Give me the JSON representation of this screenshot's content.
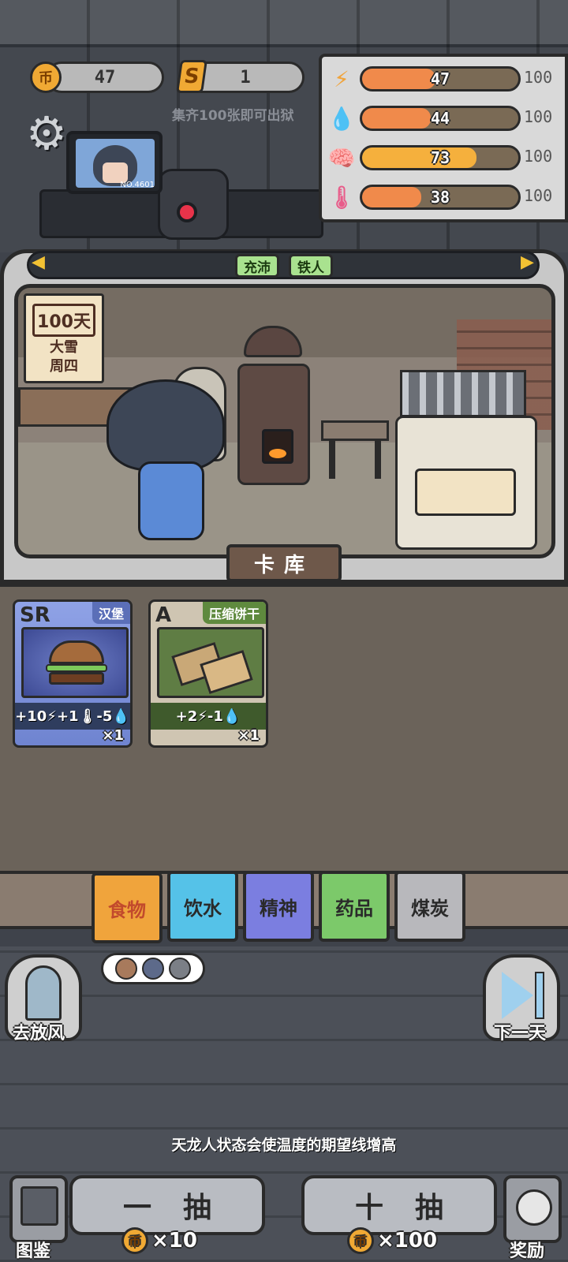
{
  "currency": {
    "coins": "47",
    "coin_symbol": "币",
    "s_symbol": "S",
    "s_count": "1"
  },
  "escape_hint": "集齐100张即可出狱",
  "prisoner_no": "NO.4601",
  "stats": [
    {
      "name": "energy",
      "icon": "lightning-icon",
      "glyph": "⚡",
      "value": "47",
      "max": "100",
      "fill": 0.47,
      "color": "#f08a4b"
    },
    {
      "name": "water",
      "icon": "water-drop-icon",
      "glyph": "💧",
      "value": "44",
      "max": "100",
      "fill": 0.44,
      "color": "#f08a4b"
    },
    {
      "name": "mind",
      "icon": "brain-icon",
      "glyph": "🧠",
      "value": "73",
      "max": "100",
      "fill": 0.73,
      "color": "#f5b03d"
    },
    {
      "name": "temperature",
      "icon": "thermometer-icon",
      "glyph": "🌡",
      "value": "38",
      "max": "100",
      "fill": 0.38,
      "color": "#f08a4b"
    }
  ],
  "status_tags": [
    "充沛",
    "铁人"
  ],
  "calendar": {
    "days": "100天",
    "weather": "大雪",
    "weekday": "周四"
  },
  "card_library_label": "卡库",
  "cards": [
    {
      "rank": "SR",
      "name": "汉堡",
      "effect": "+10⚡+1🌡-5💧",
      "count": "×1",
      "bg": "#8fa2e6",
      "name_bg": "#5b6fb8",
      "rank_color": "#ffffff"
    },
    {
      "rank": "A",
      "name": "压缩饼干",
      "effect": "+2⚡-1💧",
      "count": "×1",
      "bg": "#cfc5b2",
      "name_bg": "#5f8a3e",
      "rank_color": "#2a2a2a"
    }
  ],
  "categories": [
    {
      "label": "食物",
      "color": "#f0a43c",
      "active": true
    },
    {
      "label": "饮水",
      "color": "#55c2e8",
      "active": false
    },
    {
      "label": "精神",
      "color": "#7b7ee0",
      "active": false
    },
    {
      "label": "药品",
      "color": "#7cc96a",
      "active": false
    },
    {
      "label": "煤炭",
      "color": "#b8b8bc",
      "active": false
    }
  ],
  "buttons": {
    "yard": "去放风",
    "next_day": "下一天",
    "codex": "图鉴",
    "reward": "奖励",
    "draw_one": "一抽",
    "draw_ten": "十抽",
    "cost_one": "×10",
    "cost_ten": "×100"
  },
  "hint": "天龙人状态会使温度的期望线增高"
}
